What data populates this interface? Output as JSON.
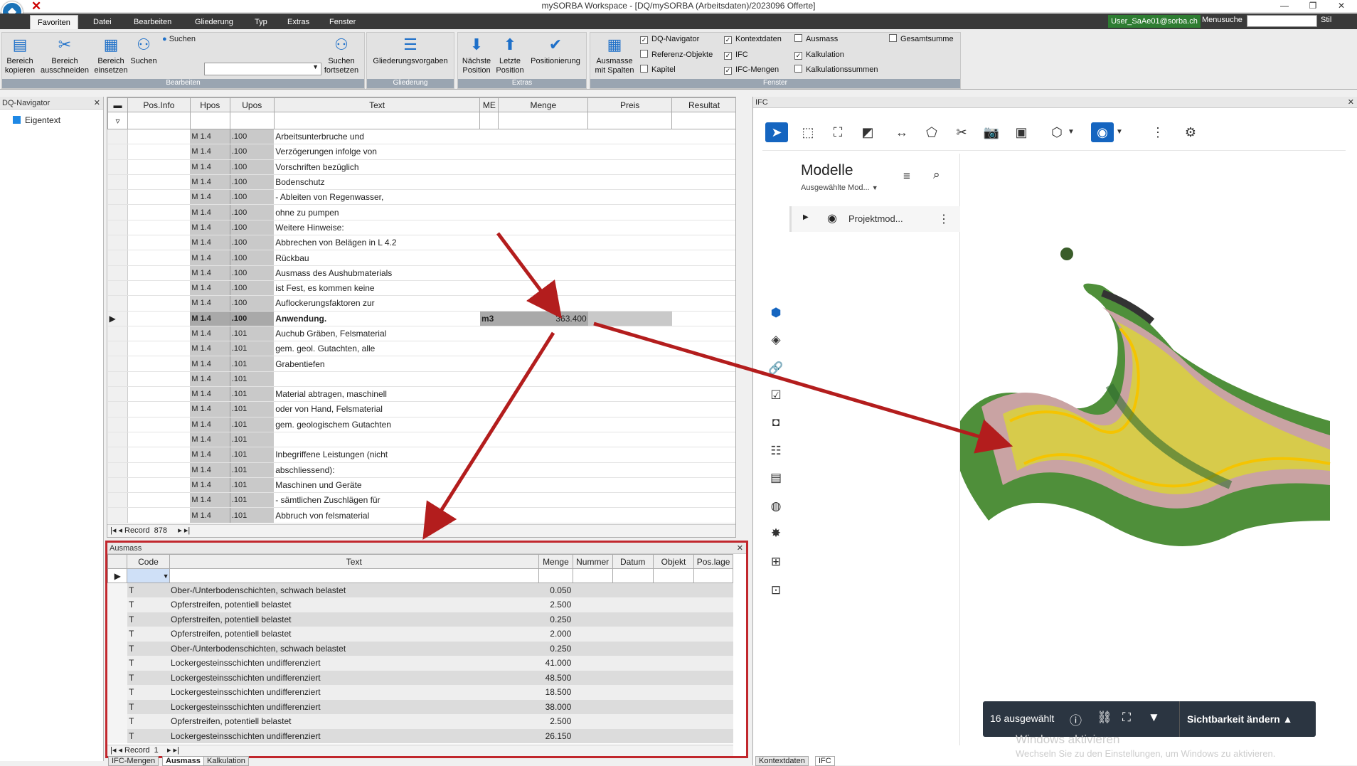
{
  "window": {
    "title": "mySORBA Workspace - [DQ/mySORBA (Arbeitsdaten)/2023096 Offerte]",
    "min": "—",
    "restore": "❐",
    "close": "✕"
  },
  "menu": {
    "tabs": [
      "Favoriten",
      "Datei",
      "Bearbeiten",
      "Gliederung",
      "Typ",
      "Extras",
      "Fenster"
    ],
    "user": "User_SaAe01@sorba.ch",
    "menusuche": "Menusuche",
    "stil": "Stil"
  },
  "ribbon": {
    "bearbeiten": {
      "label": "Bearbeiten",
      "b1": "Bereich\nkopieren",
      "b2": "Bereich\nausschneiden",
      "b3": "Bereich\neinsetzen",
      "b4": "Suchen",
      "suchen_label": "Suchen",
      "b5": "Suchen\nfortsetzen"
    },
    "gliederung": {
      "label": "Gliederung",
      "b1": "Gliederungsvorgaben"
    },
    "extras": {
      "label": "Extras",
      "b1": "Nächste\nPosition",
      "b2": "Letzte\nPosition",
      "b3": "Positionierung"
    },
    "fenster": {
      "label": "Fenster",
      "b1": "Ausmasse\nmit Spalten",
      "checks": [
        {
          "label": "DQ-Navigator",
          "checked": true
        },
        {
          "label": "Referenz-Objekte",
          "checked": false
        },
        {
          "label": "Kapitel",
          "checked": false
        },
        {
          "label": "Kontextdaten",
          "checked": true
        },
        {
          "label": "IFC",
          "checked": true
        },
        {
          "label": "IFC-Mengen",
          "checked": true
        },
        {
          "label": "Ausmass",
          "checked": false
        },
        {
          "label": "Kalkulation",
          "checked": true
        },
        {
          "label": "Kalkulationssummen",
          "checked": false
        },
        {
          "label": "Gesamtsumme",
          "checked": false
        }
      ]
    }
  },
  "navigator": {
    "title": "DQ-Navigator",
    "item": "Eigentext"
  },
  "grid": {
    "headers": [
      "Pos.Info",
      "Hpos",
      "Upos",
      "Text",
      "ME",
      "Menge",
      "Preis",
      "Resultat"
    ],
    "rows": [
      {
        "h": "M 1.4",
        "u": ".100",
        "t": "Arbeitsunterbruche und"
      },
      {
        "h": "M 1.4",
        "u": ".100",
        "t": "Verzögerungen infolge von"
      },
      {
        "h": "M 1.4",
        "u": ".100",
        "t": "Vorschriften bezüglich"
      },
      {
        "h": "M 1.4",
        "u": ".100",
        "t": "Bodenschutz"
      },
      {
        "h": "M 1.4",
        "u": ".100",
        "t": "- Ableiten von Regenwasser,"
      },
      {
        "h": "M 1.4",
        "u": ".100",
        "t": "ohne zu pumpen"
      },
      {
        "h": "M 1.4",
        "u": ".100",
        "t": "Weitere Hinweise:"
      },
      {
        "h": "M 1.4",
        "u": ".100",
        "t": "Abbrechen von Belägen in L 4.2"
      },
      {
        "h": "M 1.4",
        "u": ".100",
        "t": "Rückbau"
      },
      {
        "h": "M 1.4",
        "u": ".100",
        "t": "Ausmass des Aushubmaterials"
      },
      {
        "h": "M 1.4",
        "u": ".100",
        "t": "ist Fest, es kommen keine"
      },
      {
        "h": "M 1.4",
        "u": ".100",
        "t": "Auflockerungsfaktoren zur"
      },
      {
        "h": "M 1.4",
        "u": ".100",
        "t": "Anwendung.",
        "me": "m3",
        "menge": "363.400",
        "sel": true
      },
      {
        "h": "M 1.4",
        "u": ".101",
        "t": "Auchub Gräben, Felsmaterial"
      },
      {
        "h": "M 1.4",
        "u": ".101",
        "t": "gem. geol. Gutachten, alle"
      },
      {
        "h": "M 1.4",
        "u": ".101",
        "t": "Grabentiefen"
      },
      {
        "h": "M 1.4",
        "u": ".101",
        "t": ""
      },
      {
        "h": "M 1.4",
        "u": ".101",
        "t": "Material abtragen, maschinell"
      },
      {
        "h": "M 1.4",
        "u": ".101",
        "t": "oder von Hand, Felsmaterial"
      },
      {
        "h": "M 1.4",
        "u": ".101",
        "t": "gem. geologischem Gutachten"
      },
      {
        "h": "M 1.4",
        "u": ".101",
        "t": ""
      },
      {
        "h": "M 1.4",
        "u": ".101",
        "t": "Inbegriffene Leistungen (nicht"
      },
      {
        "h": "M 1.4",
        "u": ".101",
        "t": "abschliessend):"
      },
      {
        "h": "M 1.4",
        "u": ".101",
        "t": "  Maschinen und Geräte"
      },
      {
        "h": "M 1.4",
        "u": ".101",
        "t": "- sämtlichen Zuschlägen für"
      },
      {
        "h": "M 1.4",
        "u": ".101",
        "t": "Abbruch von felsmaterial"
      }
    ],
    "record_label": "Record",
    "record": "878"
  },
  "ausmass": {
    "title": "Ausmass",
    "headers": [
      "Code",
      "Text",
      "Menge",
      "Nummer",
      "Datum",
      "Objekt",
      "Pos.lage"
    ],
    "rows": [
      {
        "c": "T",
        "t": "Ober-/Unterbodenschichten, schwach belastet",
        "m": "0.050"
      },
      {
        "c": "T",
        "t": "Opferstreifen, potentiell belastet",
        "m": "2.500"
      },
      {
        "c": "T",
        "t": "Opferstreifen, potentiell belastet",
        "m": "0.250"
      },
      {
        "c": "T",
        "t": "Opferstreifen, potentiell belastet",
        "m": "2.000"
      },
      {
        "c": "T",
        "t": "Ober-/Unterbodenschichten, schwach belastet",
        "m": "0.250"
      },
      {
        "c": "T",
        "t": "Lockergesteinsschichten undifferenziert",
        "m": "41.000"
      },
      {
        "c": "T",
        "t": "Lockergesteinsschichten undifferenziert",
        "m": "48.500"
      },
      {
        "c": "T",
        "t": "Lockergesteinsschichten undifferenziert",
        "m": "18.500"
      },
      {
        "c": "T",
        "t": "Lockergesteinsschichten undifferenziert",
        "m": "38.000"
      },
      {
        "c": "T",
        "t": "Opferstreifen, potentiell belastet",
        "m": "2.500"
      },
      {
        "c": "T",
        "t": "Lockergesteinsschichten undifferenziert",
        "m": "26.150"
      }
    ],
    "record_label": "Record",
    "record": "1"
  },
  "ifc": {
    "title": "IFC",
    "modelle": "Modelle",
    "sub": "Ausgewählte Mod...",
    "projekt": "Projektmod...",
    "selected": "16 ausgewählt",
    "sichtbarkeit": "Sichtbarkeit ändern",
    "watermark1": "Windows aktivieren",
    "watermark2": "Wechseln Sie zu den Einstellungen, um Windows zu aktivieren."
  },
  "statustabs": {
    "left": [
      "IFC-Mengen",
      "Ausmass",
      "Kalkulation"
    ],
    "right": [
      "Kontextdaten",
      "IFC"
    ]
  }
}
